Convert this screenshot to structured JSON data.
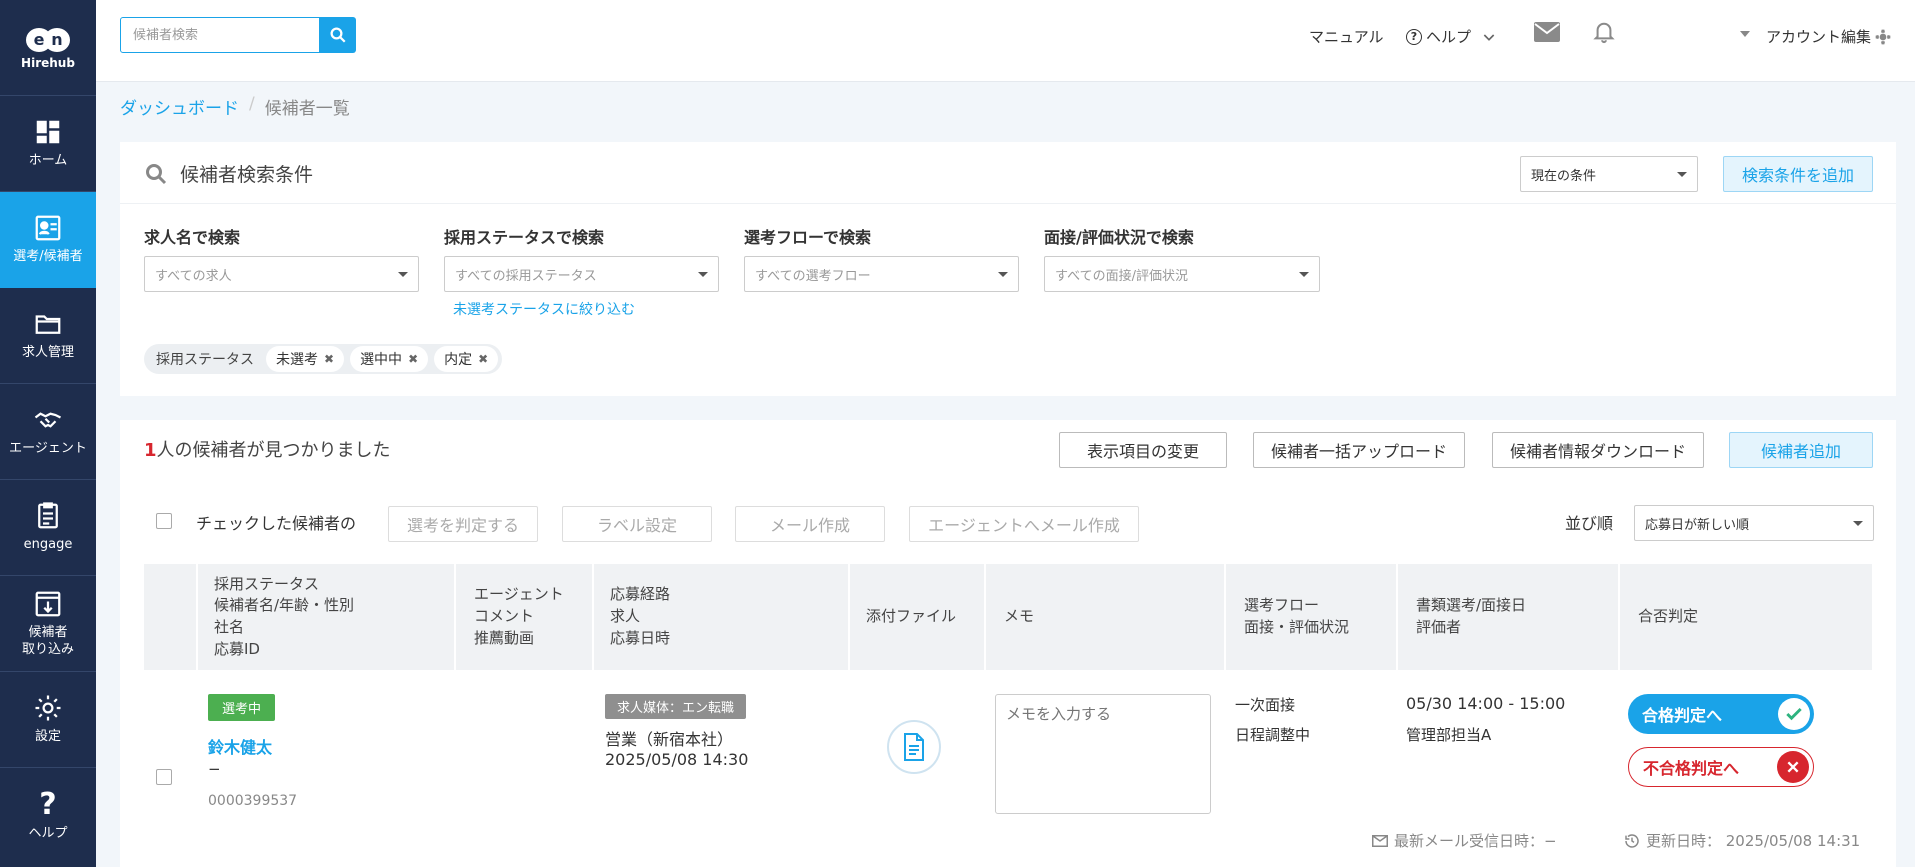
{
  "brand": {
    "logo_text": "Hirehub",
    "logo_letters": [
      "e",
      "n"
    ]
  },
  "sidebar": {
    "items": [
      {
        "id": "home",
        "label": "ホーム",
        "icon": "dashboard-icon"
      },
      {
        "id": "selection",
        "label": "選考/候補者",
        "icon": "candidate-card-icon",
        "active": true
      },
      {
        "id": "jobs",
        "label": "求人管理",
        "icon": "folder-icon"
      },
      {
        "id": "agent",
        "label": "エージェント",
        "icon": "handshake-icon"
      },
      {
        "id": "engage",
        "label": "engage",
        "icon": "clipboard-icon"
      },
      {
        "id": "import",
        "label": "候補者\n取り込み",
        "icon": "import-icon"
      },
      {
        "id": "settings",
        "label": "設定",
        "icon": "gear-icon"
      },
      {
        "id": "help",
        "label": "ヘルプ",
        "icon": "question-icon"
      }
    ]
  },
  "header": {
    "search_placeholder": "候補者検索",
    "manual": "マニュアル",
    "help": "ヘルプ",
    "account": "アカウント編集"
  },
  "breadcrumb": {
    "home": "ダッシュボード",
    "sep": "/",
    "current": "候補者一覧"
  },
  "search_panel": {
    "title": "候補者検索条件",
    "condition_select": "現在の条件",
    "add_condition": "検索条件を追加",
    "filters": [
      {
        "label": "求人名で検索",
        "placeholder": "すべての求人"
      },
      {
        "label": "採用ステータスで検索",
        "placeholder": "すべての採用ステータス"
      },
      {
        "label": "選考フローで検索",
        "placeholder": "すべての選考フロー"
      },
      {
        "label": "面接/評価状況で検索",
        "placeholder": "すべての面接/評価状況"
      }
    ],
    "narrow_link": "未選考ステータスに絞り込む",
    "chip_group_label": "採用ステータス",
    "chips": [
      "未選考",
      "選中中",
      "内定"
    ]
  },
  "results": {
    "count": "1",
    "count_suffix": "人の候補者が見つかりました",
    "buttons": {
      "columns": "表示項目の変更",
      "bulk_upload": "候補者一括アップロード",
      "download": "候補者情報ダウンロード",
      "add": "候補者追加"
    },
    "checked_label": "チェックした候補者の",
    "bulk_actions": [
      "選考を判定する",
      "ラベル設定",
      "メール作成",
      "エージェントへメール作成"
    ],
    "sort_label": "並び順",
    "sort_value": "応募日が新しい順",
    "columns": [
      [
        "採用ステータス",
        "候補者名/年齢・性別",
        "社名",
        "応募ID"
      ],
      [
        "エージェント",
        "コメント",
        "推薦動画"
      ],
      [
        "応募経路",
        "求人",
        "応募日時"
      ],
      [
        "添付ファイル"
      ],
      [
        "メモ"
      ],
      [
        "選考フロー",
        "面接・評価状況"
      ],
      [
        "書類選考/面接日",
        "評価者"
      ],
      [
        "合否判定"
      ]
    ],
    "rows": [
      {
        "status": "選考中",
        "name": "鈴木健太",
        "age_gender": "−",
        "app_id": "0000399537",
        "route_badge": "求人媒体：エン転職",
        "job": "営業（新宿本社）",
        "applied_at": "2025/05/08 14:30",
        "memo_placeholder": "メモを入力する",
        "flow": "一次面接",
        "flow_status": "日程調整中",
        "interview_time": "05/30 14:00 - 15:00",
        "evaluator": "管理部担当A",
        "pass_label": "合格判定へ",
        "fail_label": "不合格判定へ",
        "last_mail": "最新メール受信日時：−",
        "updated": "更新日時： 2025/05/08 14:31"
      }
    ]
  }
}
